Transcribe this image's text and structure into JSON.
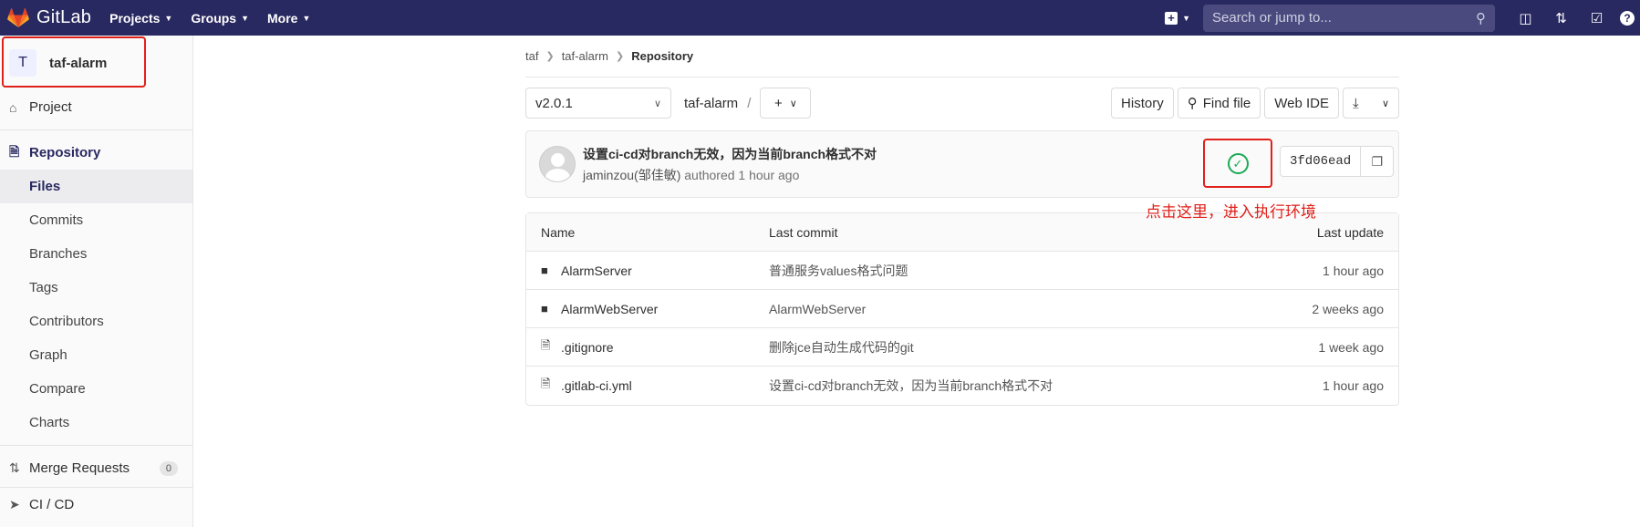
{
  "topbar": {
    "brand": "GitLab",
    "nav": [
      "Projects",
      "Groups",
      "More"
    ],
    "search_placeholder": "Search or jump to..."
  },
  "sidebar": {
    "project_initial": "T",
    "project_name": "taf-alarm",
    "project_label": "Project",
    "repository_label": "Repository",
    "repo_sub": [
      "Files",
      "Commits",
      "Branches",
      "Tags",
      "Contributors",
      "Graph",
      "Compare",
      "Charts"
    ],
    "merge_requests_label": "Merge Requests",
    "merge_requests_count": "0",
    "cicd_label": "CI / CD"
  },
  "breadcrumb": [
    "taf",
    "taf-alarm",
    "Repository"
  ],
  "tree": {
    "ref": "v2.0.1",
    "path": "taf-alarm",
    "slash": "/",
    "add": "+",
    "buttons": {
      "history": "History",
      "find_file": "Find file",
      "web_ide": "Web IDE"
    }
  },
  "commit": {
    "title": "设置ci-cd对branch无效，因为当前branch格式不对",
    "author": "jaminzou(邹佳敏)",
    "authored": "authored",
    "time": "1 hour ago",
    "sha": "3fd06ead",
    "status": "passed"
  },
  "annotation": "点击这里，进入执行环境",
  "files": {
    "headers": [
      "Name",
      "Last commit",
      "Last update"
    ],
    "rows": [
      {
        "name": "AlarmServer",
        "type": "folder",
        "commit": "普通服务values格式问题",
        "update": "1 hour ago"
      },
      {
        "name": "AlarmWebServer",
        "type": "folder",
        "commit": "AlarmWebServer",
        "update": "2 weeks ago"
      },
      {
        "name": ".gitignore",
        "type": "file",
        "commit": "删除jce自动生成代码的git",
        "update": "1 week ago"
      },
      {
        "name": ".gitlab-ci.yml",
        "type": "file",
        "commit": "设置ci-cd对branch无效，因为当前branch格式不对",
        "update": "1 hour ago"
      }
    ]
  },
  "colors": {
    "topbar": "#292961",
    "annotation": "#e0201a",
    "status_green": "#1aaa55"
  }
}
